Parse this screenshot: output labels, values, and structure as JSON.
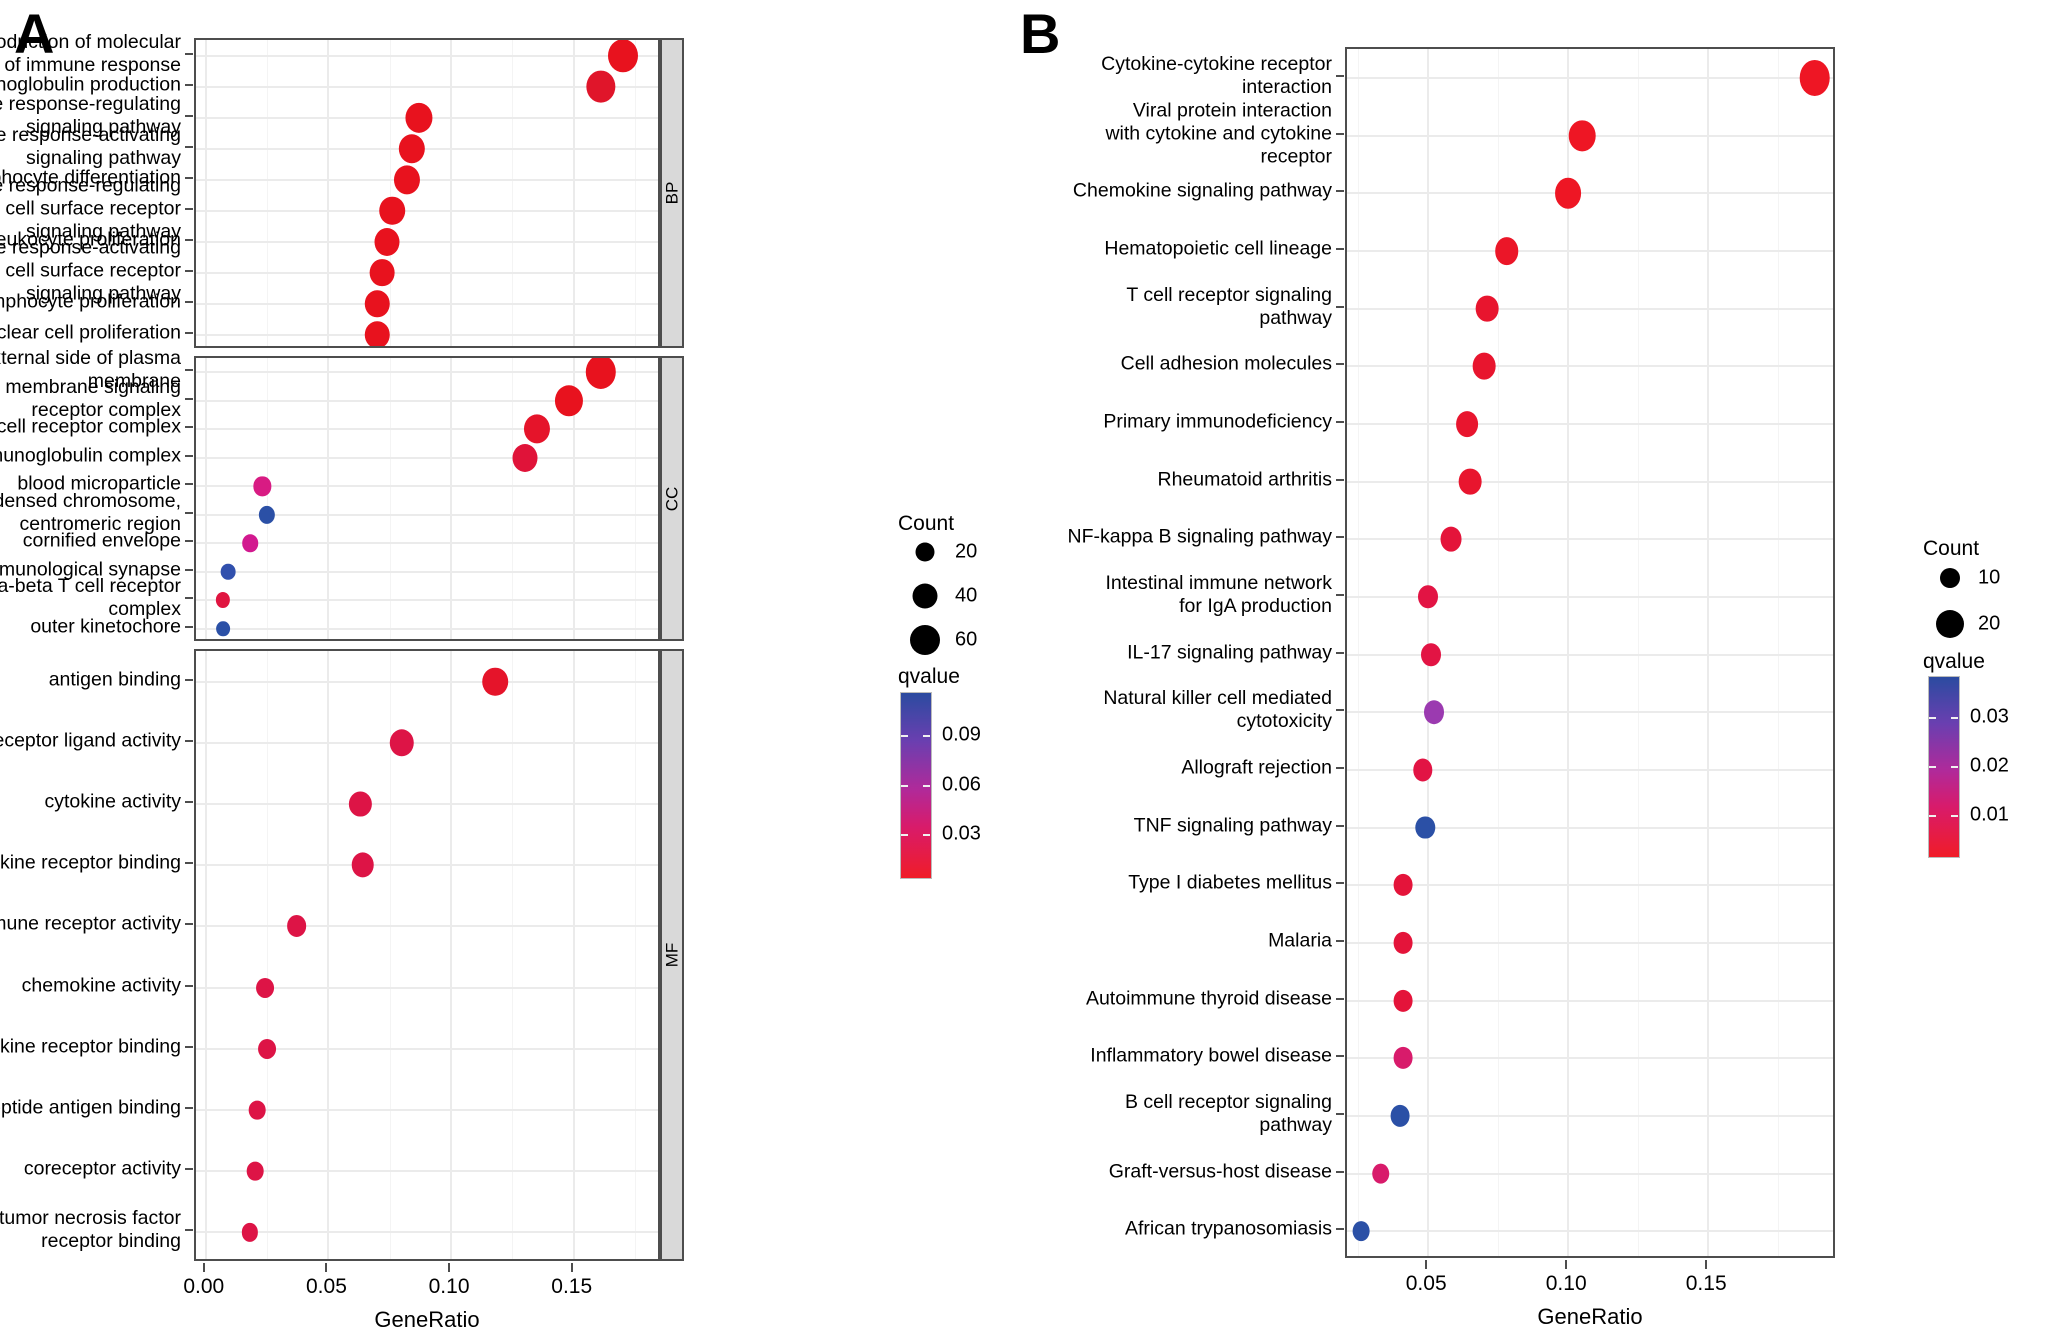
{
  "figure": {
    "panels": [
      {
        "letter": "A"
      },
      {
        "letter": "B"
      }
    ]
  },
  "panelA": {
    "letter": "A",
    "xlabel": "GeneRatio",
    "xticks": [
      "0.00",
      "0.05",
      "0.10",
      "0.15"
    ],
    "xtick_values": [
      0.0,
      0.05,
      0.1,
      0.15
    ],
    "facets": [
      {
        "strip": "BP"
      },
      {
        "strip": "CC"
      },
      {
        "strip": "MF"
      }
    ],
    "legend_count": {
      "title": "Count",
      "labels": [
        "20",
        "40",
        "60"
      ],
      "values": [
        20,
        40,
        60
      ]
    },
    "legend_qvalue": {
      "title": "qvalue",
      "labels": [
        "0.09",
        "0.06",
        "0.03"
      ],
      "values": [
        0.09,
        0.06,
        0.03
      ],
      "high_color": "#2b4ba0",
      "low_color": "#f01c28"
    }
  },
  "panelB": {
    "letter": "B",
    "xlabel": "GeneRatio",
    "xticks": [
      "0.05",
      "0.10",
      "0.15"
    ],
    "xtick_values": [
      0.05,
      0.1,
      0.15
    ],
    "legend_count": {
      "title": "Count",
      "labels": [
        "10",
        "20"
      ],
      "values": [
        10,
        20
      ]
    },
    "legend_qvalue": {
      "title": "qvalue",
      "labels": [
        "0.03",
        "0.02",
        "0.01"
      ],
      "values": [
        0.03,
        0.02,
        0.01
      ],
      "high_color": "#2b4ba0",
      "low_color": "#f01c28"
    }
  },
  "chart_data": [
    {
      "type": "scatter",
      "title": "A",
      "xlabel": "GeneRatio",
      "ylabel": "",
      "xlim": [
        -0.004,
        0.186
      ],
      "xticks": [
        0.0,
        0.05,
        0.1,
        0.15
      ],
      "grid": true,
      "size_legend": {
        "name": "Count",
        "breaks": [
          20,
          40,
          60
        ]
      },
      "color_legend": {
        "name": "qvalue",
        "breaks": [
          0.09,
          0.06,
          0.03
        ],
        "scale": "blue-to-red"
      },
      "facets": [
        {
          "name": "BP",
          "points": [
            {
              "term": "production of molecular\nmediator of immune response",
              "GeneRatio": 0.17,
              "Count": 60,
              "qvalue": 0.004,
              "color": "#e8121e"
            },
            {
              "term": "immunoglobulin production",
              "GeneRatio": 0.161,
              "Count": 57,
              "qvalue": 0.004,
              "color": "#e0152a"
            },
            {
              "term": "immune response-regulating\nsignaling pathway",
              "GeneRatio": 0.087,
              "Count": 48,
              "qvalue": 0.004,
              "color": "#e8121e"
            },
            {
              "term": "immune response-activating\nsignaling pathway",
              "GeneRatio": 0.084,
              "Count": 45,
              "qvalue": 0.004,
              "color": "#e8121e"
            },
            {
              "term": "lymphocyte differentiation",
              "GeneRatio": 0.082,
              "Count": 44,
              "qvalue": 0.004,
              "color": "#e8121e"
            },
            {
              "term": "immune response-regulating\ncell surface receptor\nsignaling pathway",
              "GeneRatio": 0.076,
              "Count": 42,
              "qvalue": 0.004,
              "color": "#e8121e"
            },
            {
              "term": "leukocyte proliferation",
              "GeneRatio": 0.074,
              "Count": 40,
              "qvalue": 0.004,
              "color": "#e8121e"
            },
            {
              "term": "immune response-activating\ncell surface receptor\nsignaling pathway",
              "GeneRatio": 0.072,
              "Count": 39,
              "qvalue": 0.004,
              "color": "#e8121e"
            },
            {
              "term": "lymphocyte proliferation",
              "GeneRatio": 0.07,
              "Count": 38,
              "qvalue": 0.004,
              "color": "#e8121e"
            },
            {
              "term": "mononuclear cell proliferation",
              "GeneRatio": 0.07,
              "Count": 38,
              "qvalue": 0.004,
              "color": "#e8121e"
            }
          ]
        },
        {
          "name": "CC",
          "points": [
            {
              "term": "external side of plasma\nmembrane",
              "GeneRatio": 0.161,
              "Count": 62,
              "qvalue": 0.003,
              "color": "#e8121e"
            },
            {
              "term": "plasma membrane signaling\nreceptor complex",
              "GeneRatio": 0.148,
              "Count": 52,
              "qvalue": 0.003,
              "color": "#e8121e"
            },
            {
              "term": "T cell receptor complex",
              "GeneRatio": 0.135,
              "Count": 44,
              "qvalue": 0.004,
              "color": "#e5142a"
            },
            {
              "term": "immunoglobulin complex",
              "GeneRatio": 0.13,
              "Count": 40,
              "qvalue": 0.005,
              "color": "#e01339"
            },
            {
              "term": "blood microparticle",
              "GeneRatio": 0.023,
              "Count": 14,
              "qvalue": 0.042,
              "color": "#d81b83"
            },
            {
              "term": "condensed chromosome,\ncentromeric region",
              "GeneRatio": 0.025,
              "Count": 11,
              "qvalue": 0.098,
              "color": "#2b50a6"
            },
            {
              "term": "cornified envelope",
              "GeneRatio": 0.018,
              "Count": 9,
              "qvalue": 0.049,
              "color": "#d2198f"
            },
            {
              "term": "immunological synapse",
              "GeneRatio": 0.009,
              "Count": 7,
              "qvalue": 0.095,
              "color": "#3150ad"
            },
            {
              "term": "alpha-beta T cell receptor\ncomplex",
              "GeneRatio": 0.007,
              "Count": 6,
              "qvalue": 0.01,
              "color": "#e01540"
            },
            {
              "term": "outer kinetochore",
              "GeneRatio": 0.007,
              "Count": 5,
              "qvalue": 0.1,
              "color": "#2b50a6"
            }
          ]
        },
        {
          "name": "MF",
          "points": [
            {
              "term": "antigen binding",
              "GeneRatio": 0.118,
              "Count": 42,
              "qvalue": 0.004,
              "color": "#e5142a"
            },
            {
              "term": "receptor ligand activity",
              "GeneRatio": 0.08,
              "Count": 38,
              "qvalue": 0.006,
              "color": "#dd1446"
            },
            {
              "term": "cytokine activity",
              "GeneRatio": 0.063,
              "Count": 30,
              "qvalue": 0.006,
              "color": "#dd1446"
            },
            {
              "term": "cytokine receptor binding",
              "GeneRatio": 0.064,
              "Count": 31,
              "qvalue": 0.006,
              "color": "#dd1446"
            },
            {
              "term": "immune receptor activity",
              "GeneRatio": 0.037,
              "Count": 22,
              "qvalue": 0.006,
              "color": "#dd1446"
            },
            {
              "term": "chemokine activity",
              "GeneRatio": 0.024,
              "Count": 16,
              "qvalue": 0.007,
              "color": "#dd1446"
            },
            {
              "term": "chemokine receptor binding",
              "GeneRatio": 0.025,
              "Count": 16,
              "qvalue": 0.007,
              "color": "#dd1446"
            },
            {
              "term": "peptide antigen binding",
              "GeneRatio": 0.021,
              "Count": 12,
              "qvalue": 0.007,
              "color": "#dd1446"
            },
            {
              "term": "coreceptor activity",
              "GeneRatio": 0.02,
              "Count": 12,
              "qvalue": 0.007,
              "color": "#dd1446"
            },
            {
              "term": "tumor necrosis factor\nreceptor binding",
              "GeneRatio": 0.018,
              "Count": 11,
              "qvalue": 0.007,
              "color": "#dd1446"
            }
          ]
        }
      ]
    },
    {
      "type": "scatter",
      "title": "B",
      "xlabel": "GeneRatio",
      "ylabel": "",
      "xlim": [
        0.021,
        0.196
      ],
      "xticks": [
        0.05,
        0.1,
        0.15
      ],
      "grid": true,
      "size_legend": {
        "name": "Count",
        "breaks": [
          10,
          20
        ]
      },
      "color_legend": {
        "name": "qvalue",
        "breaks": [
          0.03,
          0.02,
          0.01
        ],
        "scale": "blue-to-red"
      },
      "points": [
        {
          "term": "Cytokine-cytokine receptor\ninteraction",
          "GeneRatio": 0.188,
          "Count": 24,
          "qvalue": 0.001,
          "color": "#ee1624"
        },
        {
          "term": "Viral protein interaction\nwith cytokine and cytokine\nreceptor",
          "GeneRatio": 0.105,
          "Count": 18,
          "qvalue": 0.001,
          "color": "#ee1624"
        },
        {
          "term": "Chemokine signaling pathway",
          "GeneRatio": 0.1,
          "Count": 17,
          "qvalue": 0.001,
          "color": "#ee1624"
        },
        {
          "term": "Hematopoietic cell lineage",
          "GeneRatio": 0.078,
          "Count": 14,
          "qvalue": 0.002,
          "color": "#eb1628"
        },
        {
          "term": "T cell receptor signaling\npathway",
          "GeneRatio": 0.071,
          "Count": 13,
          "qvalue": 0.003,
          "color": "#e8152e"
        },
        {
          "term": "Cell adhesion molecules",
          "GeneRatio": 0.07,
          "Count": 13,
          "qvalue": 0.003,
          "color": "#e8152e"
        },
        {
          "term": "Primary immunodeficiency",
          "GeneRatio": 0.064,
          "Count": 12,
          "qvalue": 0.003,
          "color": "#e8152e"
        },
        {
          "term": "Rheumatoid arthritis",
          "GeneRatio": 0.065,
          "Count": 13,
          "qvalue": 0.003,
          "color": "#e8152e"
        },
        {
          "term": "NF-kappa B signaling pathway",
          "GeneRatio": 0.058,
          "Count": 11,
          "qvalue": 0.004,
          "color": "#e4143a"
        },
        {
          "term": "Intestinal immune network\nfor IgA production",
          "GeneRatio": 0.05,
          "Count": 10,
          "qvalue": 0.005,
          "color": "#e21444"
        },
        {
          "term": "IL-17 signaling pathway",
          "GeneRatio": 0.051,
          "Count": 10,
          "qvalue": 0.005,
          "color": "#e21444"
        },
        {
          "term": "Natural killer cell mediated\ncytotoxicity",
          "GeneRatio": 0.052,
          "Count": 10,
          "qvalue": 0.024,
          "color": "#9b3ab0"
        },
        {
          "term": "Allograft rejection",
          "GeneRatio": 0.048,
          "Count": 9,
          "qvalue": 0.005,
          "color": "#e21444"
        },
        {
          "term": "TNF signaling pathway",
          "GeneRatio": 0.049,
          "Count": 9,
          "qvalue": 0.032,
          "color": "#2b50a6"
        },
        {
          "term": "Type I diabetes mellitus",
          "GeneRatio": 0.041,
          "Count": 8,
          "qvalue": 0.006,
          "color": "#e4143a"
        },
        {
          "term": "Malaria",
          "GeneRatio": 0.041,
          "Count": 8,
          "qvalue": 0.006,
          "color": "#e4143a"
        },
        {
          "term": "Autoimmune thyroid disease",
          "GeneRatio": 0.041,
          "Count": 8,
          "qvalue": 0.006,
          "color": "#e4143a"
        },
        {
          "term": "Inflammatory bowel disease",
          "GeneRatio": 0.041,
          "Count": 8,
          "qvalue": 0.009,
          "color": "#d81b6b"
        },
        {
          "term": "B cell receptor signaling\npathway",
          "GeneRatio": 0.04,
          "Count": 8,
          "qvalue": 0.031,
          "color": "#2b50a6"
        },
        {
          "term": "Graft-versus-host disease",
          "GeneRatio": 0.033,
          "Count": 6,
          "qvalue": 0.01,
          "color": "#d81b6b"
        },
        {
          "term": "African trypanosomiasis",
          "GeneRatio": 0.026,
          "Count": 5,
          "qvalue": 0.033,
          "color": "#2b50a6"
        }
      ]
    }
  ]
}
